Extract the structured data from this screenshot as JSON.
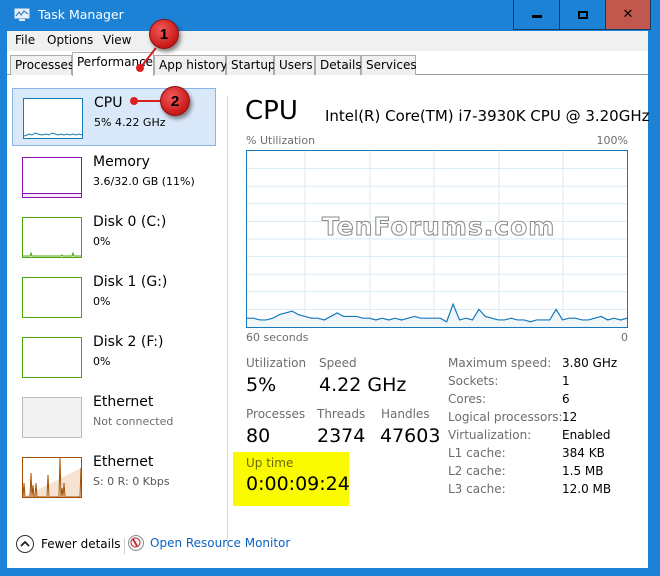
{
  "window": {
    "title": "Task Manager",
    "controls": {
      "minimize": "minimize",
      "maximize": "maximize",
      "close": "close"
    }
  },
  "menu": [
    "File",
    "Options",
    "View"
  ],
  "tabs": [
    {
      "label": "Processes",
      "active": false
    },
    {
      "label": "Performance",
      "active": true
    },
    {
      "label": "App history",
      "active": false
    },
    {
      "label": "Startup",
      "active": false
    },
    {
      "label": "Users",
      "active": false
    },
    {
      "label": "Details",
      "active": false
    },
    {
      "label": "Services",
      "active": false
    }
  ],
  "resources": [
    {
      "name": "CPU",
      "sub": "5% 4.22 GHz",
      "color": "#1779ba",
      "selected": true
    },
    {
      "name": "Memory",
      "sub": "3.6/32.0 GB (11%)",
      "color": "#8b12ae",
      "selected": false
    },
    {
      "name": "Disk 0 (C:)",
      "sub": "0%",
      "color": "#4da60c",
      "selected": false
    },
    {
      "name": "Disk 1 (G:)",
      "sub": "0%",
      "color": "#4da60c",
      "selected": false
    },
    {
      "name": "Disk 2 (F:)",
      "sub": "0%",
      "color": "#4da60c",
      "selected": false
    },
    {
      "name": "Ethernet",
      "sub": "Not connected",
      "color": "#bcbcbc",
      "selected": false,
      "disabled": true
    },
    {
      "name": "Ethernet",
      "sub": "S: 0 R: 0 Kbps",
      "color": "#a74f01",
      "selected": false
    }
  ],
  "cpu": {
    "title": "CPU",
    "model": "Intel(R) Core(TM) i7-3930K CPU @ 3.20GHz",
    "graph": {
      "y_label": "% Utilization",
      "y_max_label": "100%",
      "x_left_label": "60 seconds",
      "x_right_label": "0",
      "line_color": "#1779ba",
      "fill_color": "#f1f6fa",
      "grid_color": "#d9eaf4",
      "utilization_history": [
        5,
        5,
        4,
        4,
        5,
        7,
        8,
        9,
        7,
        6,
        5,
        5,
        4,
        6,
        8,
        6,
        6,
        6,
        5,
        5,
        4,
        5,
        4,
        5,
        4,
        5,
        6,
        5,
        5,
        5,
        5,
        3,
        13,
        4,
        5,
        4,
        10,
        6,
        5,
        4,
        4,
        5,
        4,
        4,
        3,
        4,
        4,
        4,
        10,
        4,
        5,
        5,
        4,
        4,
        5,
        6,
        4,
        5,
        4,
        5
      ]
    },
    "watermark": "TenForums.com",
    "stats": {
      "utilization": {
        "label": "Utilization",
        "value": "5%"
      },
      "speed": {
        "label": "Speed",
        "value": "4.22 GHz"
      },
      "processes": {
        "label": "Processes",
        "value": "80"
      },
      "threads": {
        "label": "Threads",
        "value": "2374"
      },
      "handles": {
        "label": "Handles",
        "value": "47603"
      },
      "uptime": {
        "label": "Up time",
        "value": "0:00:09:24"
      }
    },
    "specs": [
      {
        "label": "Maximum speed:",
        "value": "3.80 GHz"
      },
      {
        "label": "Sockets:",
        "value": "1"
      },
      {
        "label": "Cores:",
        "value": "6"
      },
      {
        "label": "Logical processors:",
        "value": "12"
      },
      {
        "label": "Virtualization:",
        "value": "Enabled"
      },
      {
        "label": "L1 cache:",
        "value": "384 KB"
      },
      {
        "label": "L2 cache:",
        "value": "1.5 MB"
      },
      {
        "label": "L3 cache:",
        "value": "12.0 MB"
      }
    ]
  },
  "footer": {
    "fewer_details": "Fewer details",
    "resource_monitor": "Open Resource Monitor"
  },
  "annotations": [
    {
      "number": "1",
      "target": "Performance tab"
    },
    {
      "number": "2",
      "target": "CPU"
    }
  ]
}
